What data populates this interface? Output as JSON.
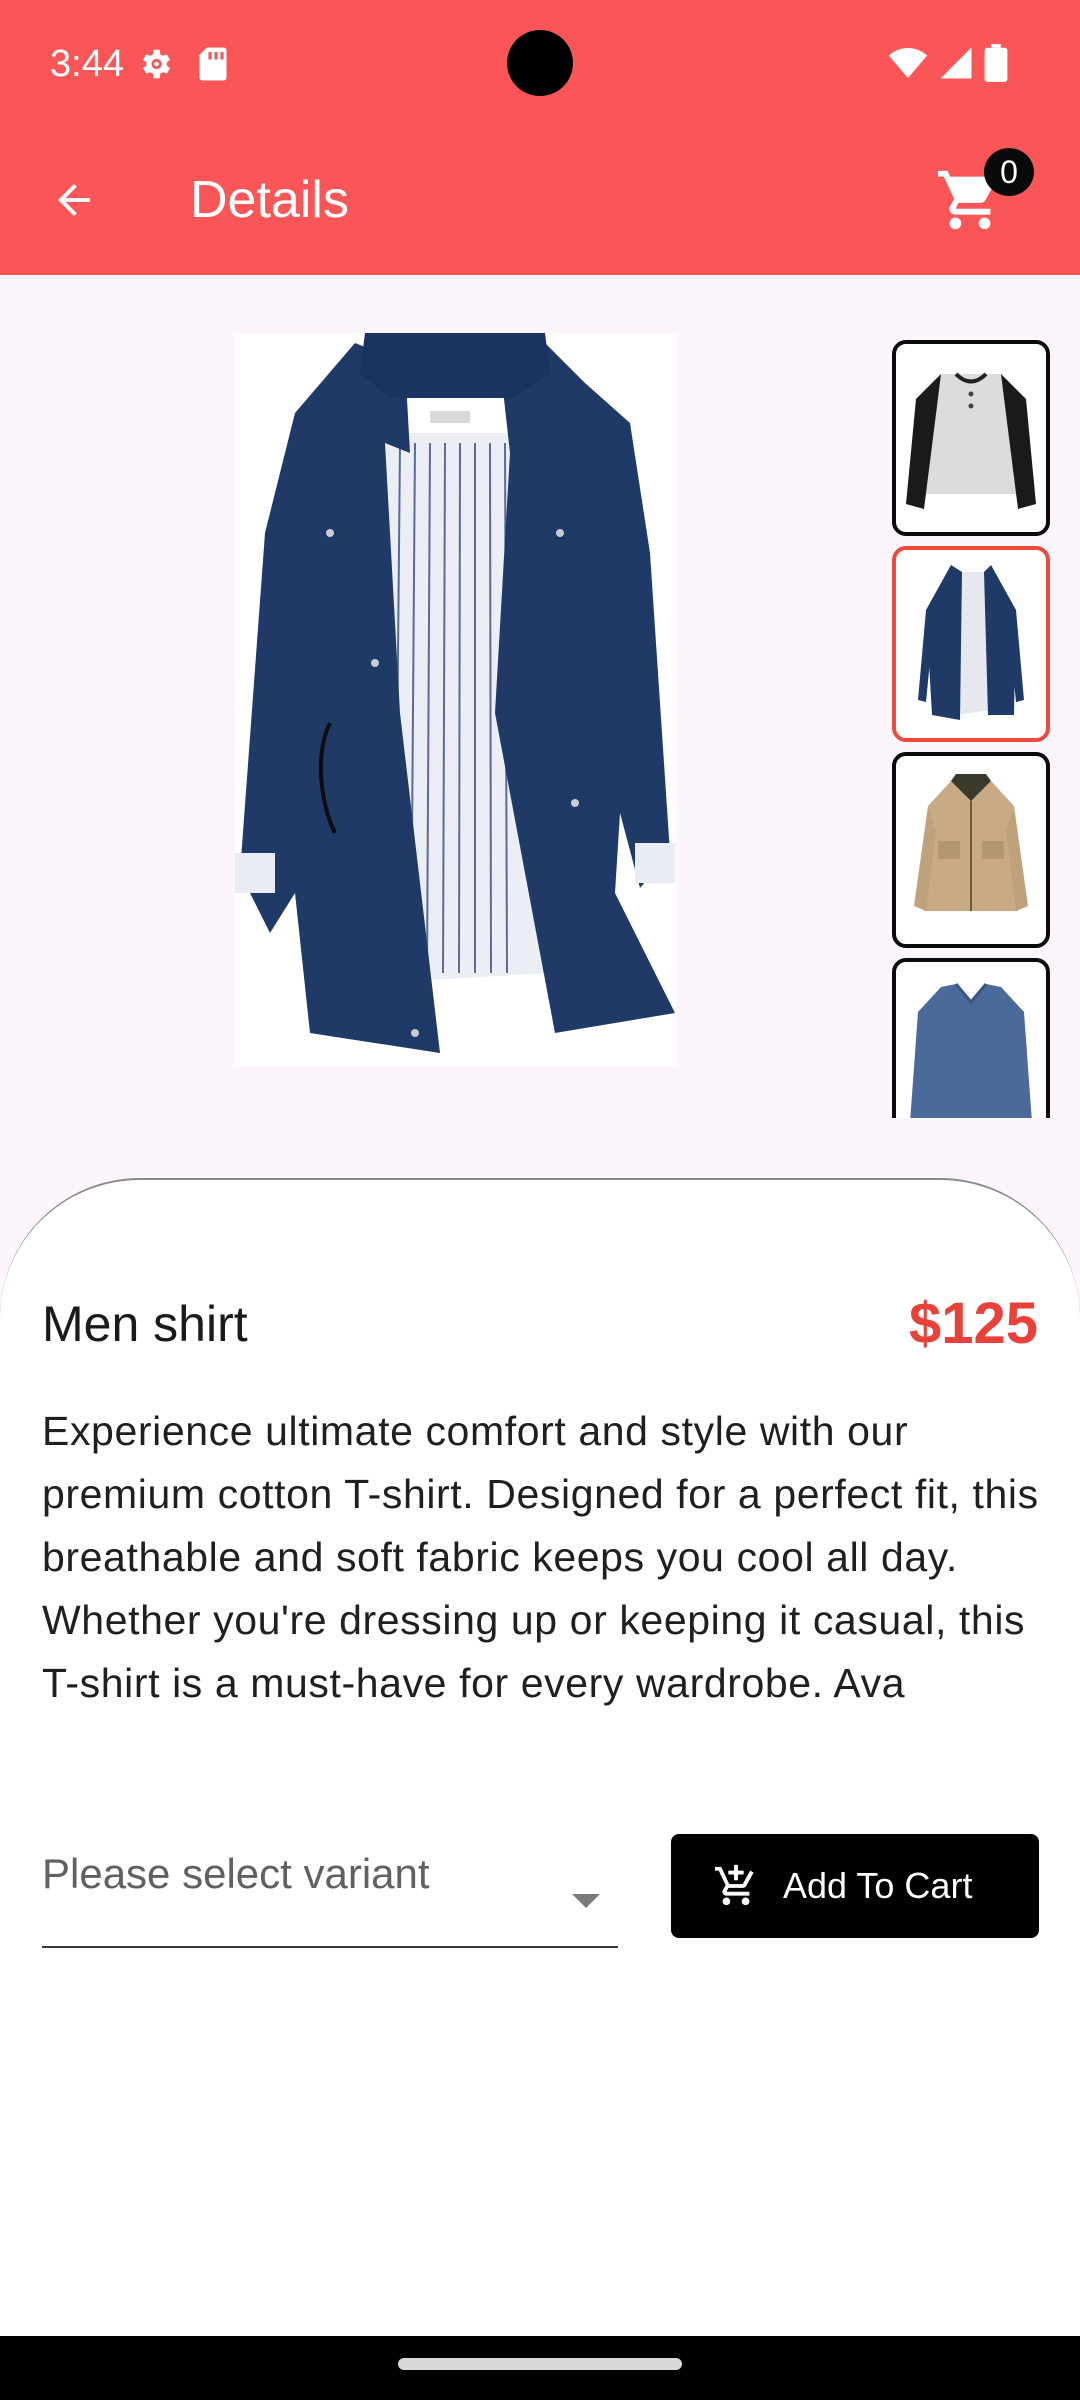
{
  "status_bar": {
    "time": "3:44",
    "icons": [
      "gear-icon",
      "sd-card-icon",
      "wifi-icon",
      "signal-icon",
      "battery-icon"
    ]
  },
  "app_bar": {
    "title": "Details",
    "back_icon": "arrow-back-icon",
    "cart_icon": "shopping-cart-icon",
    "cart_count": "0"
  },
  "gallery": {
    "main_image": "navy-trench-jacket",
    "thumbnails": [
      {
        "name": "raglan-henley-shirt",
        "selected": false
      },
      {
        "name": "navy-trench-jacket",
        "selected": true
      },
      {
        "name": "khaki-field-jacket",
        "selected": false
      },
      {
        "name": "blue-long-sleeve-shirt",
        "selected": false
      }
    ]
  },
  "product": {
    "name": "Men shirt",
    "price": "$125",
    "description": "Experience ultimate comfort and style with our premium cotton T-shirt. Designed for a perfect fit, this breathable and soft fabric keeps you cool all day. Whether you're dressing up or keeping it casual, this T-shirt is a must-have for every wardrobe. Ava"
  },
  "variant": {
    "placeholder": "Please select variant"
  },
  "add_to_cart": {
    "label": "Add To Cart",
    "icon": "add-shopping-cart-icon"
  },
  "colors": {
    "app_bar": "#fb5657",
    "price": "#e8413a",
    "selected_thumb_border": "#f0483e",
    "button": "#000000"
  }
}
